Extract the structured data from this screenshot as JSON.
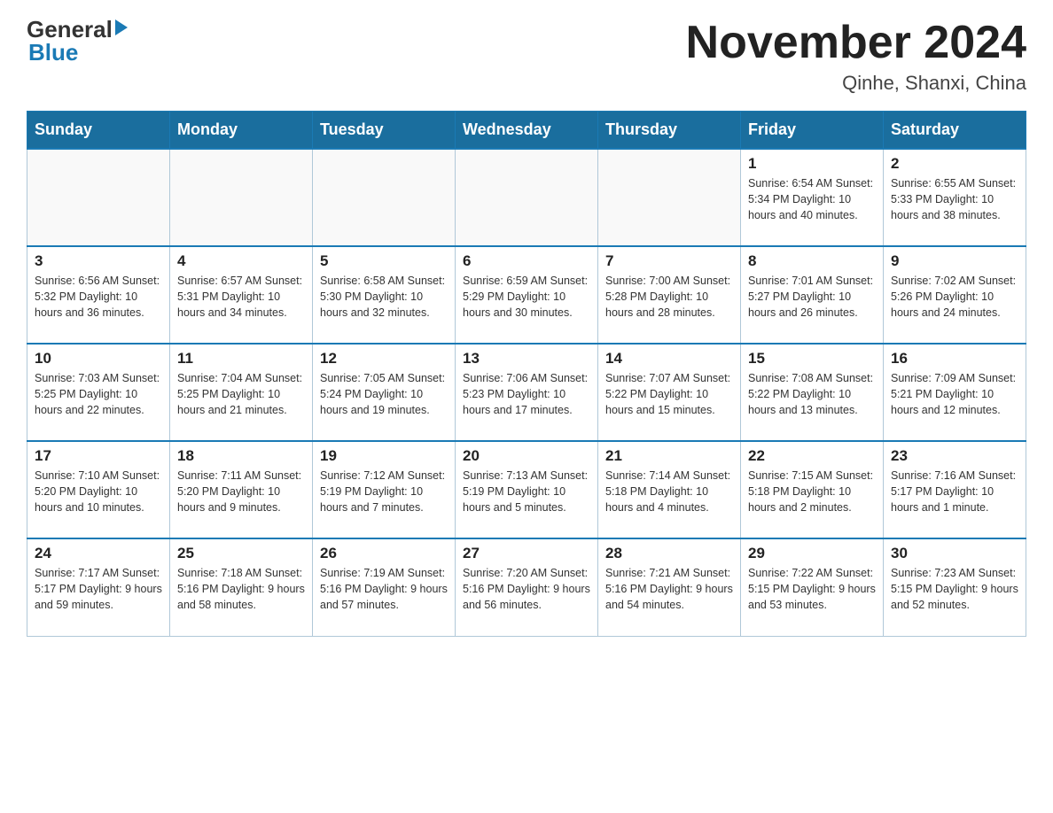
{
  "logo": {
    "general": "General",
    "blue": "Blue"
  },
  "header": {
    "month": "November 2024",
    "location": "Qinhe, Shanxi, China"
  },
  "weekdays": [
    "Sunday",
    "Monday",
    "Tuesday",
    "Wednesday",
    "Thursday",
    "Friday",
    "Saturday"
  ],
  "weeks": [
    [
      {
        "day": "",
        "info": ""
      },
      {
        "day": "",
        "info": ""
      },
      {
        "day": "",
        "info": ""
      },
      {
        "day": "",
        "info": ""
      },
      {
        "day": "",
        "info": ""
      },
      {
        "day": "1",
        "info": "Sunrise: 6:54 AM\nSunset: 5:34 PM\nDaylight: 10 hours and 40 minutes."
      },
      {
        "day": "2",
        "info": "Sunrise: 6:55 AM\nSunset: 5:33 PM\nDaylight: 10 hours and 38 minutes."
      }
    ],
    [
      {
        "day": "3",
        "info": "Sunrise: 6:56 AM\nSunset: 5:32 PM\nDaylight: 10 hours and 36 minutes."
      },
      {
        "day": "4",
        "info": "Sunrise: 6:57 AM\nSunset: 5:31 PM\nDaylight: 10 hours and 34 minutes."
      },
      {
        "day": "5",
        "info": "Sunrise: 6:58 AM\nSunset: 5:30 PM\nDaylight: 10 hours and 32 minutes."
      },
      {
        "day": "6",
        "info": "Sunrise: 6:59 AM\nSunset: 5:29 PM\nDaylight: 10 hours and 30 minutes."
      },
      {
        "day": "7",
        "info": "Sunrise: 7:00 AM\nSunset: 5:28 PM\nDaylight: 10 hours and 28 minutes."
      },
      {
        "day": "8",
        "info": "Sunrise: 7:01 AM\nSunset: 5:27 PM\nDaylight: 10 hours and 26 minutes."
      },
      {
        "day": "9",
        "info": "Sunrise: 7:02 AM\nSunset: 5:26 PM\nDaylight: 10 hours and 24 minutes."
      }
    ],
    [
      {
        "day": "10",
        "info": "Sunrise: 7:03 AM\nSunset: 5:25 PM\nDaylight: 10 hours and 22 minutes."
      },
      {
        "day": "11",
        "info": "Sunrise: 7:04 AM\nSunset: 5:25 PM\nDaylight: 10 hours and 21 minutes."
      },
      {
        "day": "12",
        "info": "Sunrise: 7:05 AM\nSunset: 5:24 PM\nDaylight: 10 hours and 19 minutes."
      },
      {
        "day": "13",
        "info": "Sunrise: 7:06 AM\nSunset: 5:23 PM\nDaylight: 10 hours and 17 minutes."
      },
      {
        "day": "14",
        "info": "Sunrise: 7:07 AM\nSunset: 5:22 PM\nDaylight: 10 hours and 15 minutes."
      },
      {
        "day": "15",
        "info": "Sunrise: 7:08 AM\nSunset: 5:22 PM\nDaylight: 10 hours and 13 minutes."
      },
      {
        "day": "16",
        "info": "Sunrise: 7:09 AM\nSunset: 5:21 PM\nDaylight: 10 hours and 12 minutes."
      }
    ],
    [
      {
        "day": "17",
        "info": "Sunrise: 7:10 AM\nSunset: 5:20 PM\nDaylight: 10 hours and 10 minutes."
      },
      {
        "day": "18",
        "info": "Sunrise: 7:11 AM\nSunset: 5:20 PM\nDaylight: 10 hours and 9 minutes."
      },
      {
        "day": "19",
        "info": "Sunrise: 7:12 AM\nSunset: 5:19 PM\nDaylight: 10 hours and 7 minutes."
      },
      {
        "day": "20",
        "info": "Sunrise: 7:13 AM\nSunset: 5:19 PM\nDaylight: 10 hours and 5 minutes."
      },
      {
        "day": "21",
        "info": "Sunrise: 7:14 AM\nSunset: 5:18 PM\nDaylight: 10 hours and 4 minutes."
      },
      {
        "day": "22",
        "info": "Sunrise: 7:15 AM\nSunset: 5:18 PM\nDaylight: 10 hours and 2 minutes."
      },
      {
        "day": "23",
        "info": "Sunrise: 7:16 AM\nSunset: 5:17 PM\nDaylight: 10 hours and 1 minute."
      }
    ],
    [
      {
        "day": "24",
        "info": "Sunrise: 7:17 AM\nSunset: 5:17 PM\nDaylight: 9 hours and 59 minutes."
      },
      {
        "day": "25",
        "info": "Sunrise: 7:18 AM\nSunset: 5:16 PM\nDaylight: 9 hours and 58 minutes."
      },
      {
        "day": "26",
        "info": "Sunrise: 7:19 AM\nSunset: 5:16 PM\nDaylight: 9 hours and 57 minutes."
      },
      {
        "day": "27",
        "info": "Sunrise: 7:20 AM\nSunset: 5:16 PM\nDaylight: 9 hours and 56 minutes."
      },
      {
        "day": "28",
        "info": "Sunrise: 7:21 AM\nSunset: 5:16 PM\nDaylight: 9 hours and 54 minutes."
      },
      {
        "day": "29",
        "info": "Sunrise: 7:22 AM\nSunset: 5:15 PM\nDaylight: 9 hours and 53 minutes."
      },
      {
        "day": "30",
        "info": "Sunrise: 7:23 AM\nSunset: 5:15 PM\nDaylight: 9 hours and 52 minutes."
      }
    ]
  ]
}
